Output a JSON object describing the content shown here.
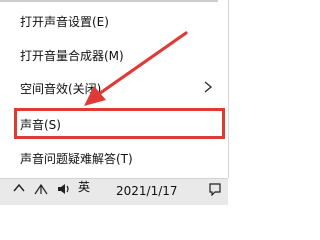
{
  "menu": {
    "items": [
      {
        "label": "打开声音设置(E)"
      },
      {
        "label": "打开音量合成器(M)"
      },
      {
        "label": "空间音效(关闭)"
      },
      {
        "label": "声音(S)"
      },
      {
        "label": "声音问题疑难解答(T)"
      }
    ]
  },
  "taskbar": {
    "language": "英",
    "date": "2021/1/17"
  },
  "colors": {
    "highlight": "#e03a36",
    "menu_text": "#111111"
  },
  "icons": [
    "chevron-right-icon",
    "chevron-up-icon",
    "network-icon",
    "notification-icon"
  ]
}
